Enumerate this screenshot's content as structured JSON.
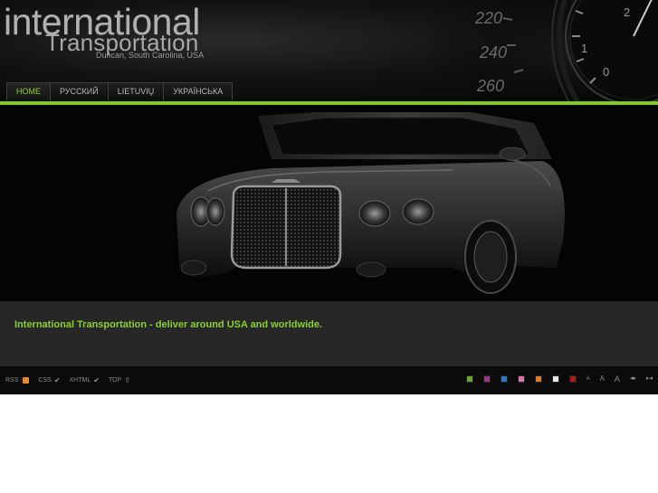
{
  "header": {
    "logo_main": "international",
    "logo_sub": "Transportation",
    "logo_location": "Duncan, South Carolina, USA",
    "gauge_numbers": [
      "220",
      "240",
      "260",
      "2",
      "1",
      "0"
    ]
  },
  "nav": {
    "items": [
      {
        "label": "HOME",
        "active": true
      },
      {
        "label": "РУССКИЙ",
        "active": false
      },
      {
        "label": "LIETUVIŲ",
        "active": false
      },
      {
        "label": "УКРАЇНСЬКА",
        "active": false
      }
    ]
  },
  "main": {
    "tagline": "International Transportation - deliver around USA and worldwide."
  },
  "footer": {
    "rss_label": "RSS",
    "css_label": "CSS",
    "xhtml_label": "XHTML",
    "top_label": "TOP",
    "swatches": [
      {
        "name": "green",
        "color": "#6aa32a"
      },
      {
        "name": "purple",
        "color": "#a0308c"
      },
      {
        "name": "blue",
        "color": "#2f78c8"
      },
      {
        "name": "pink",
        "color": "#e072b0"
      },
      {
        "name": "orange",
        "color": "#e07a2a"
      },
      {
        "name": "white",
        "color": "#e8e8e8"
      },
      {
        "name": "red",
        "color": "#b01818"
      }
    ],
    "font_small": "A",
    "font_medium": "A",
    "font_large": "A",
    "width_toggle_1": "◂▸",
    "width_toggle_2": "▸◂"
  },
  "colors": {
    "accent": "#7fcc20",
    "tagline": "#8bd12a",
    "band": "#272727",
    "background": "#000000"
  }
}
